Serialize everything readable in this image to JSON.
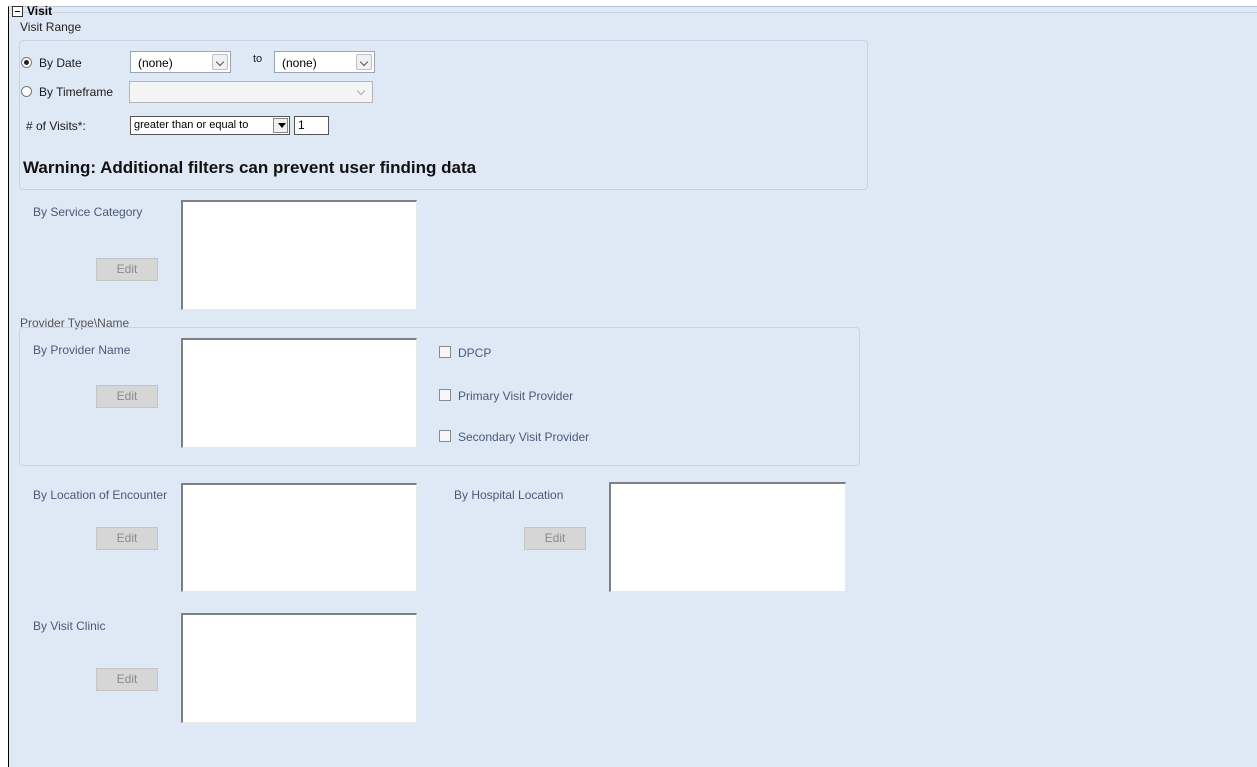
{
  "section": {
    "title": "Visit"
  },
  "visit_range": {
    "label": "Visit Range",
    "by_date": {
      "label": "By Date",
      "selected": true,
      "from": "(none)",
      "to_label": "to",
      "to": "(none)"
    },
    "by_timeframe": {
      "label": "By Timeframe",
      "selected": false,
      "value": ""
    },
    "num_visits": {
      "label": "# of Visits*:",
      "operator": "greater than or equal to",
      "value": "1"
    },
    "warning": "Warning: Additional filters can prevent user finding data"
  },
  "service_category": {
    "label": "By Service Category",
    "edit_label": "Edit"
  },
  "provider": {
    "group_label": "Provider Type\\Name",
    "name_label": "By Provider Name",
    "edit_label": "Edit",
    "checkboxes": [
      {
        "label": "DPCP",
        "checked": false
      },
      {
        "label": "Primary Visit Provider",
        "checked": false
      },
      {
        "label": "Secondary Visit Provider",
        "checked": false
      }
    ]
  },
  "location_encounter": {
    "label": "By Location of Encounter",
    "edit_label": "Edit"
  },
  "hospital_location": {
    "label": "By Hospital Location",
    "edit_label": "Edit"
  },
  "visit_clinic": {
    "label": "By Visit Clinic",
    "edit_label": "Edit"
  }
}
